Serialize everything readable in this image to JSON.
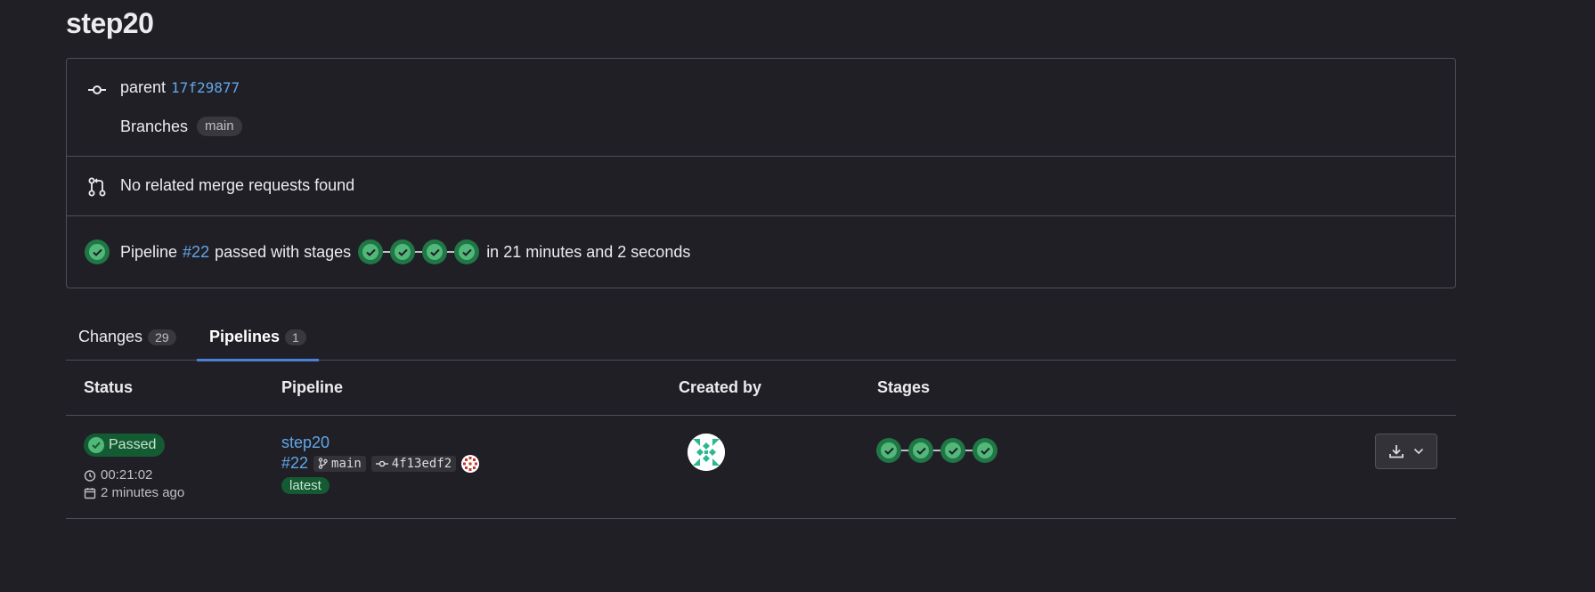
{
  "page": {
    "title": "step20"
  },
  "commit": {
    "parent_label": "parent",
    "parent_sha": "17f29877",
    "branches_label": "Branches",
    "branch": "main"
  },
  "merge_requests": {
    "text": "No related merge requests found"
  },
  "pipeline_summary": {
    "prefix": "Pipeline",
    "id": "#22",
    "passed_text": "passed with stages",
    "duration_text": "in 21 minutes and 2 seconds",
    "stage_count": 4
  },
  "tabs": [
    {
      "label": "Changes",
      "count": "29"
    },
    {
      "label": "Pipelines",
      "count": "1"
    }
  ],
  "table": {
    "headers": {
      "status": "Status",
      "pipeline": "Pipeline",
      "created_by": "Created by",
      "stages": "Stages"
    },
    "rows": [
      {
        "status": "Passed",
        "duration": "00:21:02",
        "finished": "2 minutes ago",
        "name": "step20",
        "id": "#22",
        "ref": "main",
        "sha": "4f13edf2",
        "badge": "latest"
      }
    ]
  },
  "colors": {
    "background": "#1f1f25",
    "link": "#63a6e9",
    "success": "#52b87a",
    "success_dark": "#217645",
    "tab_underline": "#4c7fd6"
  }
}
